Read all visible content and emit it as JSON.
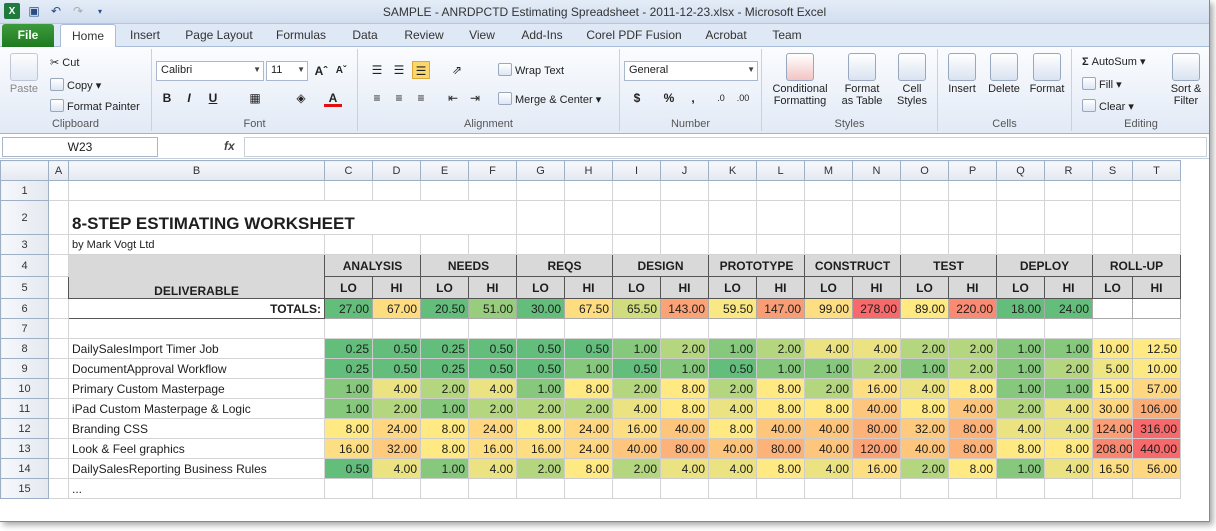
{
  "window": {
    "title": "SAMPLE - ANRDPCTD Estimating Spreadsheet - 2011-12-23.xlsx  -  Microsoft Excel"
  },
  "tabs": [
    "File",
    "Home",
    "Insert",
    "Page Layout",
    "Formulas",
    "Data",
    "Review",
    "View",
    "Add-Ins",
    "Corel PDF Fusion",
    "Acrobat",
    "Team"
  ],
  "ribbon": {
    "clipboard": {
      "label": "Clipboard",
      "paste": "Paste",
      "cut": "Cut",
      "copy": "Copy",
      "format_painter": "Format Painter"
    },
    "font": {
      "label": "Font",
      "name": "Calibri",
      "size": "11"
    },
    "alignment": {
      "label": "Alignment",
      "wrap": "Wrap Text",
      "merge": "Merge & Center"
    },
    "number": {
      "label": "Number",
      "format": "General"
    },
    "styles": {
      "label": "Styles",
      "cond": "Conditional\nFormatting",
      "table": "Format\nas Table",
      "cell": "Cell\nStyles"
    },
    "cells": {
      "label": "Cells",
      "insert": "Insert",
      "delete": "Delete",
      "format": "Format"
    },
    "editing": {
      "label": "Editing",
      "autosum": "AutoSum",
      "fill": "Fill",
      "clear": "Clear",
      "sort": "Sort &\nFilter"
    }
  },
  "formula_bar": {
    "name_box": "W23",
    "fx": "fx"
  },
  "columns": [
    "A",
    "B",
    "C",
    "D",
    "E",
    "F",
    "G",
    "H",
    "I",
    "J",
    "K",
    "L",
    "M",
    "N",
    "O",
    "P",
    "Q",
    "R",
    "S",
    "T"
  ],
  "sheet": {
    "title": "8-STEP ESTIMATING WORKSHEET",
    "byline": "by Mark Vogt Ltd",
    "deliverable_header": "DELIVERABLE",
    "phases": [
      "ANALYSIS",
      "NEEDS",
      "REQS",
      "DESIGN",
      "PROTOTYPE",
      "CONSTRUCT",
      "TEST",
      "DEPLOY",
      "ROLL-UP"
    ],
    "lo": "LO",
    "hi": "HI",
    "totals_label": "TOTALS:",
    "totals": [
      "27.00",
      "67.00",
      "20.50",
      "51.00",
      "30.00",
      "67.50",
      "65.50",
      "143.00",
      "59.50",
      "147.00",
      "99.00",
      "278.00",
      "89.00",
      "220.00",
      "18.00",
      "24.00",
      "",
      ""
    ],
    "rows": [
      {
        "name": "DailySalesImport Timer Job",
        "vals": [
          "0.25",
          "0.50",
          "0.25",
          "0.50",
          "0.50",
          "0.50",
          "1.00",
          "2.00",
          "1.00",
          "2.00",
          "4.00",
          "4.00",
          "2.00",
          "2.00",
          "1.00",
          "1.00",
          "10.00",
          "12.50"
        ]
      },
      {
        "name": "DocumentApproval Workflow",
        "vals": [
          "0.25",
          "0.50",
          "0.25",
          "0.50",
          "0.50",
          "1.00",
          "0.50",
          "1.00",
          "0.50",
          "1.00",
          "1.00",
          "2.00",
          "1.00",
          "2.00",
          "1.00",
          "2.00",
          "5.00",
          "10.00"
        ]
      },
      {
        "name": "Primary Custom Masterpage",
        "vals": [
          "1.00",
          "4.00",
          "2.00",
          "4.00",
          "1.00",
          "8.00",
          "2.00",
          "8.00",
          "2.00",
          "8.00",
          "2.00",
          "16.00",
          "4.00",
          "8.00",
          "1.00",
          "1.00",
          "15.00",
          "57.00"
        ]
      },
      {
        "name": "iPad Custom Masterpage & Logic",
        "vals": [
          "1.00",
          "2.00",
          "1.00",
          "2.00",
          "2.00",
          "2.00",
          "4.00",
          "8.00",
          "4.00",
          "8.00",
          "8.00",
          "40.00",
          "8.00",
          "40.00",
          "2.00",
          "4.00",
          "30.00",
          "106.00"
        ]
      },
      {
        "name": "Branding CSS",
        "vals": [
          "8.00",
          "24.00",
          "8.00",
          "24.00",
          "8.00",
          "24.00",
          "16.00",
          "40.00",
          "8.00",
          "40.00",
          "40.00",
          "80.00",
          "32.00",
          "80.00",
          "4.00",
          "4.00",
          "124.00",
          "316.00"
        ]
      },
      {
        "name": "Look & Feel graphics",
        "vals": [
          "16.00",
          "32.00",
          "8.00",
          "16.00",
          "16.00",
          "24.00",
          "40.00",
          "80.00",
          "40.00",
          "80.00",
          "40.00",
          "120.00",
          "40.00",
          "80.00",
          "8.00",
          "8.00",
          "208.00",
          "440.00"
        ]
      },
      {
        "name": "DailySalesReporting Business Rules",
        "vals": [
          "0.50",
          "4.00",
          "1.00",
          "4.00",
          "2.00",
          "8.00",
          "2.00",
          "4.00",
          "4.00",
          "8.00",
          "4.00",
          "16.00",
          "2.00",
          "8.00",
          "1.00",
          "4.00",
          "16.50",
          "56.00"
        ]
      }
    ],
    "ellipsis": "..."
  },
  "colors": {
    "totals": [
      "#63be7b",
      "#fedd81",
      "#63be7b",
      "#98cd7e",
      "#63be7b",
      "#fedd81",
      "#d1dc7f",
      "#fba276",
      "#f9e883",
      "#f99d75",
      "#fede82",
      "#f8696b",
      "#fee983",
      "#fa8b72",
      "#63be7b",
      "#63be7b"
    ],
    "rows": [
      [
        "#63be7b",
        "#63be7b",
        "#63be7b",
        "#63be7b",
        "#63be7b",
        "#63be7b",
        "#86c97d",
        "#b3d67e",
        "#86c97d",
        "#b3d67e",
        "#ebe382",
        "#ebe382",
        "#b3d67e",
        "#b3d67e",
        "#86c97d",
        "#86c97d",
        "#fde983",
        "#fee983"
      ],
      [
        "#63be7b",
        "#63be7b",
        "#63be7b",
        "#63be7b",
        "#63be7b",
        "#86c97d",
        "#63be7b",
        "#86c97d",
        "#63be7b",
        "#86c97d",
        "#86c97d",
        "#b3d67e",
        "#86c97d",
        "#b3d67e",
        "#86c97d",
        "#b3d67e",
        "#eee682",
        "#fde983"
      ],
      [
        "#86c97d",
        "#ebe382",
        "#b3d67e",
        "#ebe382",
        "#86c97d",
        "#fee983",
        "#b3d67e",
        "#fee983",
        "#b3d67e",
        "#fee983",
        "#b3d67e",
        "#fede82",
        "#ebe382",
        "#fee983",
        "#86c97d",
        "#86c97d",
        "#fee983",
        "#fed780"
      ],
      [
        "#86c97d",
        "#b3d67e",
        "#86c97d",
        "#b3d67e",
        "#b3d67e",
        "#b3d67e",
        "#ebe382",
        "#fee983",
        "#ebe382",
        "#fee983",
        "#fee983",
        "#fec57d",
        "#fee983",
        "#fec57d",
        "#b3d67e",
        "#ebe382",
        "#fed780",
        "#fbad78"
      ],
      [
        "#fee983",
        "#fed780",
        "#fee983",
        "#fed780",
        "#fee983",
        "#fed780",
        "#fede82",
        "#fec57d",
        "#fee983",
        "#fec57d",
        "#fec57d",
        "#fdb27a",
        "#fdca7e",
        "#fdb27a",
        "#ebe382",
        "#ebe382",
        "#fb9d75",
        "#f8696b"
      ],
      [
        "#fede82",
        "#fdca7e",
        "#fee983",
        "#fede82",
        "#fede82",
        "#fed780",
        "#fec57d",
        "#fdb27a",
        "#fec57d",
        "#fdb27a",
        "#fec57d",
        "#fca477",
        "#fec57d",
        "#fdb27a",
        "#fee983",
        "#fee983",
        "#f98870",
        "#f8696b"
      ],
      [
        "#63be7b",
        "#ebe382",
        "#86c97d",
        "#ebe382",
        "#b3d67e",
        "#fee983",
        "#b3d67e",
        "#ebe382",
        "#ebe382",
        "#fee983",
        "#ebe382",
        "#fede82",
        "#b3d67e",
        "#fee983",
        "#86c97d",
        "#ebe382",
        "#fede82",
        "#fed780"
      ]
    ]
  }
}
